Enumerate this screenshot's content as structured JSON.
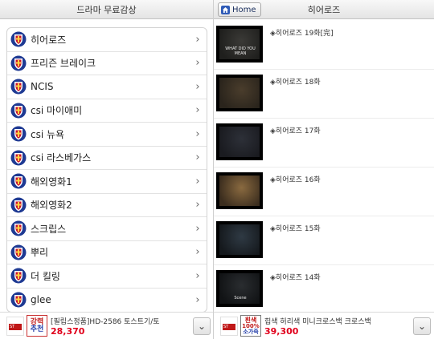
{
  "left_panel": {
    "title": "드라마 무료감상",
    "categories": [
      {
        "label": "히어로즈"
      },
      {
        "label": "프리즌 브레이크"
      },
      {
        "label": "NCIS"
      },
      {
        "label": "csi 마이애미"
      },
      {
        "label": "csi 뉴욕"
      },
      {
        "label": "csi 라스베가스"
      },
      {
        "label": "해외영화1"
      },
      {
        "label": "해외영화2"
      },
      {
        "label": "스크립스"
      },
      {
        "label": "뿌리"
      },
      {
        "label": "더 킬링"
      },
      {
        "label": "glee"
      }
    ],
    "chevron": "›",
    "ad": {
      "stamp_line1": "강력",
      "stamp_line2": "추천",
      "text": "[필립스정품]HD-2586 토스트기/토",
      "price": "28,370",
      "collapse_glyph": "⌄"
    }
  },
  "right_panel": {
    "home_label": "Home",
    "title": "히어로즈",
    "episodes": [
      {
        "title": "◈히어로즈 19화[完]",
        "caption": "WHAT DID YOU MEAN"
      },
      {
        "title": "◈히어로즈 18화",
        "caption": ""
      },
      {
        "title": "◈히어로즈 17화",
        "caption": ""
      },
      {
        "title": "◈히어로즈 16화",
        "caption": ""
      },
      {
        "title": "◈히어로즈 15화",
        "caption": ""
      },
      {
        "title": "◈히어로즈 14화",
        "caption": "Scene"
      }
    ],
    "ad": {
      "stamp_line1": "흰색",
      "stamp_line2": "100%",
      "stamp_line3": "소가죽",
      "text": "힙색 허리색 미니크로스백 크로스백",
      "price": "39,300",
      "collapse_glyph": "⌄"
    }
  },
  "colors": {
    "price": "#e0001b",
    "shield_blue": "#1f3a93",
    "shield_red": "#c8102e"
  },
  "icons": {
    "category": "shield-emblem-icon",
    "home": "home-icon",
    "chevron": "chevron-right-icon",
    "collapse": "chevron-down-double-icon"
  }
}
